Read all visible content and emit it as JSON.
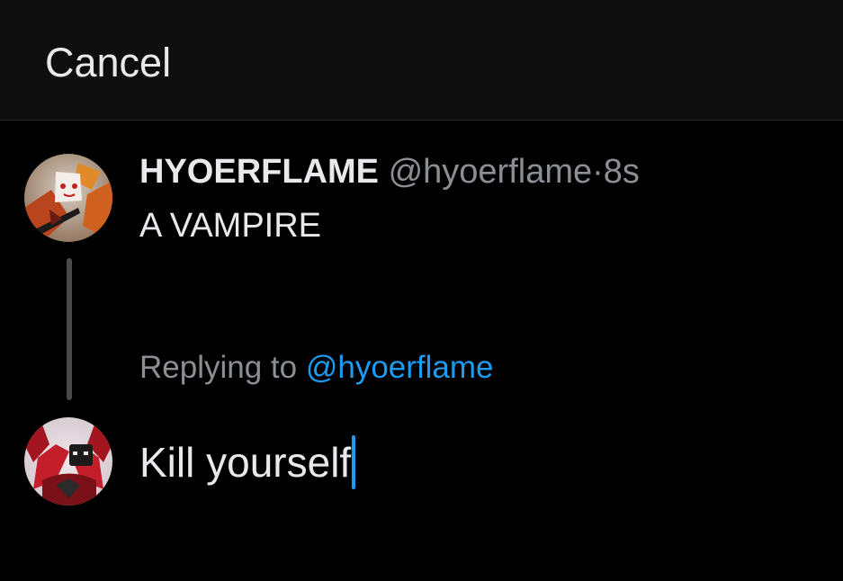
{
  "header": {
    "cancel_label": "Cancel"
  },
  "original_tweet": {
    "display_name": "HYOERFLAME",
    "handle": "@hyoerflame",
    "separator": "·",
    "time": "8s",
    "text": "A VAMPIRE",
    "avatar_icon": "profile-avatar-icon"
  },
  "reply": {
    "replying_prefix": "Replying to",
    "replying_handle": "@hyoerflame",
    "draft_text": "Kill yourself",
    "avatar_icon": "profile-avatar-icon"
  },
  "colors": {
    "background": "#000000",
    "topbar": "#0e0e0e",
    "text_primary": "#e7e9ea",
    "text_secondary": "#8b8f94",
    "accent": "#1d9bf0",
    "thread_line": "#4a4a4a"
  }
}
